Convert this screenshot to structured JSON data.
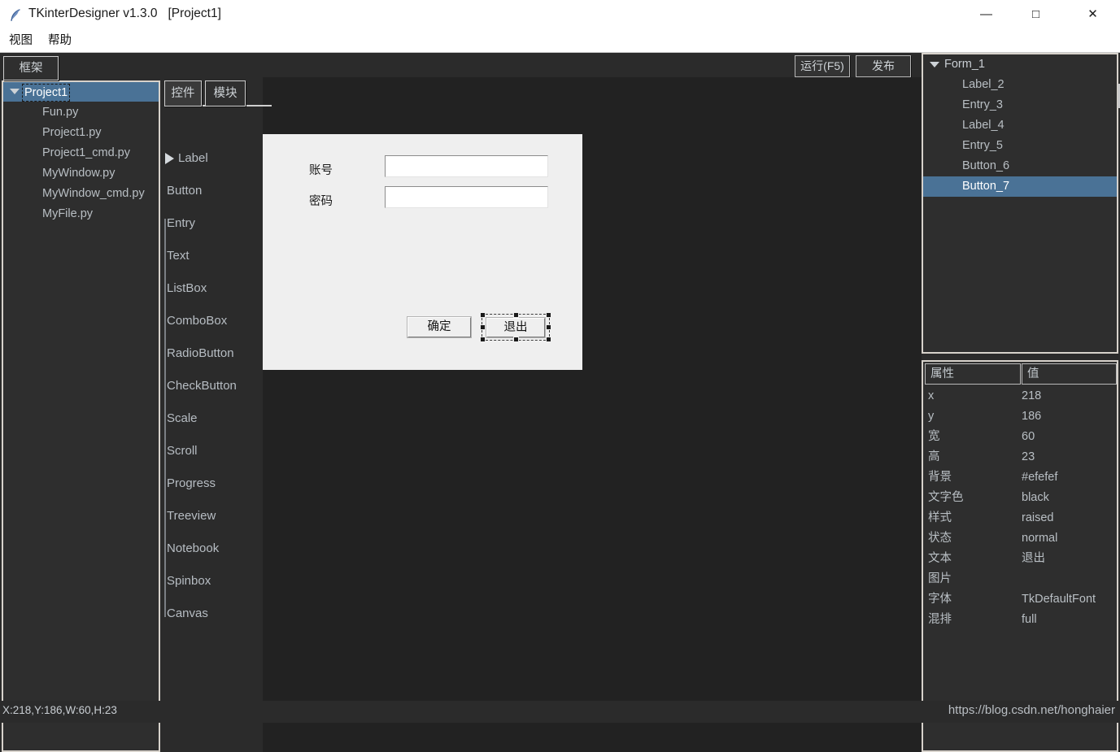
{
  "window": {
    "icon": "feather-icon",
    "title": "TKinterDesigner v1.3.0   [Project1]",
    "minimize": "—",
    "maximize": "□",
    "close": "✕"
  },
  "menubar": {
    "items": [
      {
        "label": "视图"
      },
      {
        "label": "帮助"
      }
    ]
  },
  "toolbar": {
    "run_label": "运行(F5)",
    "publish_label": "发布"
  },
  "frame_tab": {
    "label": "框架"
  },
  "project_tree": {
    "root": "Project1",
    "files": [
      {
        "label": "Fun.py"
      },
      {
        "label": "Project1.py"
      },
      {
        "label": "Project1_cmd.py"
      },
      {
        "label": "MyWindow.py"
      },
      {
        "label": "MyWindow_cmd.py"
      },
      {
        "label": "MyFile.py"
      }
    ]
  },
  "palette": {
    "tabs": [
      {
        "label": "控件",
        "active": true
      },
      {
        "label": "模块",
        "active": false
      }
    ],
    "items": [
      {
        "label": "Label"
      },
      {
        "label": "Button"
      },
      {
        "label": "Entry"
      },
      {
        "label": "Text"
      },
      {
        "label": "ListBox"
      },
      {
        "label": "ComboBox"
      },
      {
        "label": "RadioButton"
      },
      {
        "label": "CheckButton"
      },
      {
        "label": "Scale"
      },
      {
        "label": "Scroll"
      },
      {
        "label": "Progress"
      },
      {
        "label": "Treeview"
      },
      {
        "label": "Notebook"
      },
      {
        "label": "Spinbox"
      },
      {
        "label": "Canvas"
      }
    ]
  },
  "designer": {
    "form_background": "#efefef",
    "canvas_background": "#222222",
    "labels": [
      {
        "text": "账号"
      },
      {
        "text": "密码"
      }
    ],
    "entries": [
      {
        "value": "",
        "placeholder": ""
      },
      {
        "value": "",
        "placeholder": ""
      }
    ],
    "buttons": [
      {
        "text": "确定",
        "selected": false
      },
      {
        "text": "退出",
        "selected": true
      }
    ]
  },
  "object_tree": {
    "root": "Form_1",
    "nodes": [
      {
        "label": "Label_2",
        "selected": false
      },
      {
        "label": "Entry_3",
        "selected": false
      },
      {
        "label": "Label_4",
        "selected": false
      },
      {
        "label": "Entry_5",
        "selected": false
      },
      {
        "label": "Button_6",
        "selected": false
      },
      {
        "label": "Button_7",
        "selected": true
      }
    ],
    "selection_color": "#4a7296"
  },
  "properties": {
    "header_name": "属性",
    "header_value": "值",
    "rows": [
      {
        "key": "x",
        "value": "218"
      },
      {
        "key": "y",
        "value": "186"
      },
      {
        "key": "宽",
        "value": "60"
      },
      {
        "key": "高",
        "value": "23"
      },
      {
        "key": "背景",
        "value": "#efefef"
      },
      {
        "key": "文字色",
        "value": "black"
      },
      {
        "key": "样式",
        "value": "raised"
      },
      {
        "key": "状态",
        "value": "normal"
      },
      {
        "key": "文本",
        "value": "退出"
      },
      {
        "key": "图片",
        "value": ""
      },
      {
        "key": "字体",
        "value": "TkDefaultFont"
      },
      {
        "key": "混排",
        "value": "full"
      }
    ]
  },
  "statusbar": {
    "coords": "X:218,Y:186,W:60,H:23",
    "watermark": "https://blog.csdn.net/honghaier"
  }
}
